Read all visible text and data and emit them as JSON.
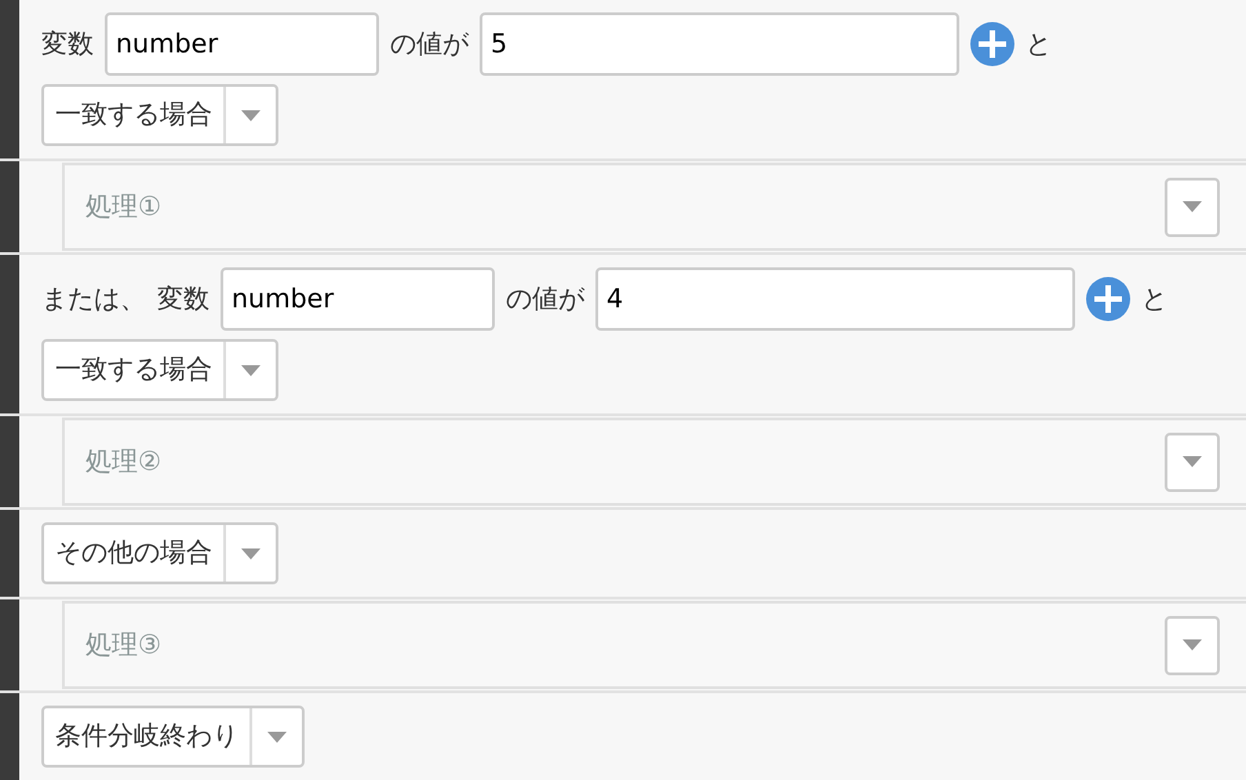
{
  "rows": [
    {
      "kind": "line",
      "items": [
        {
          "kind": "text",
          "text": "変数"
        },
        {
          "kind": "variable",
          "value": "number"
        },
        {
          "kind": "text",
          "text": "の値が"
        },
        {
          "kind": "value",
          "value": "5"
        },
        {
          "kind": "add"
        },
        {
          "kind": "text",
          "text": "と"
        },
        {
          "kind": "select",
          "label": "一致する場合"
        }
      ]
    },
    {
      "kind": "slot",
      "label": "処理①"
    },
    {
      "kind": "line",
      "items": [
        {
          "kind": "text",
          "text": "または、"
        },
        {
          "kind": "text",
          "text": "変数"
        },
        {
          "kind": "variable",
          "value": "number"
        },
        {
          "kind": "text",
          "text": "の値が"
        },
        {
          "kind": "value",
          "value": "4"
        },
        {
          "kind": "add"
        },
        {
          "kind": "text",
          "text": "と"
        },
        {
          "kind": "select",
          "label": "一致する場合"
        }
      ]
    },
    {
      "kind": "slot",
      "label": "処理②"
    },
    {
      "kind": "line",
      "items": [
        {
          "kind": "select",
          "label": "その他の場合"
        }
      ]
    },
    {
      "kind": "slot",
      "label": "処理③"
    },
    {
      "kind": "line",
      "items": [
        {
          "kind": "select",
          "label": "条件分岐終わり"
        }
      ]
    }
  ]
}
